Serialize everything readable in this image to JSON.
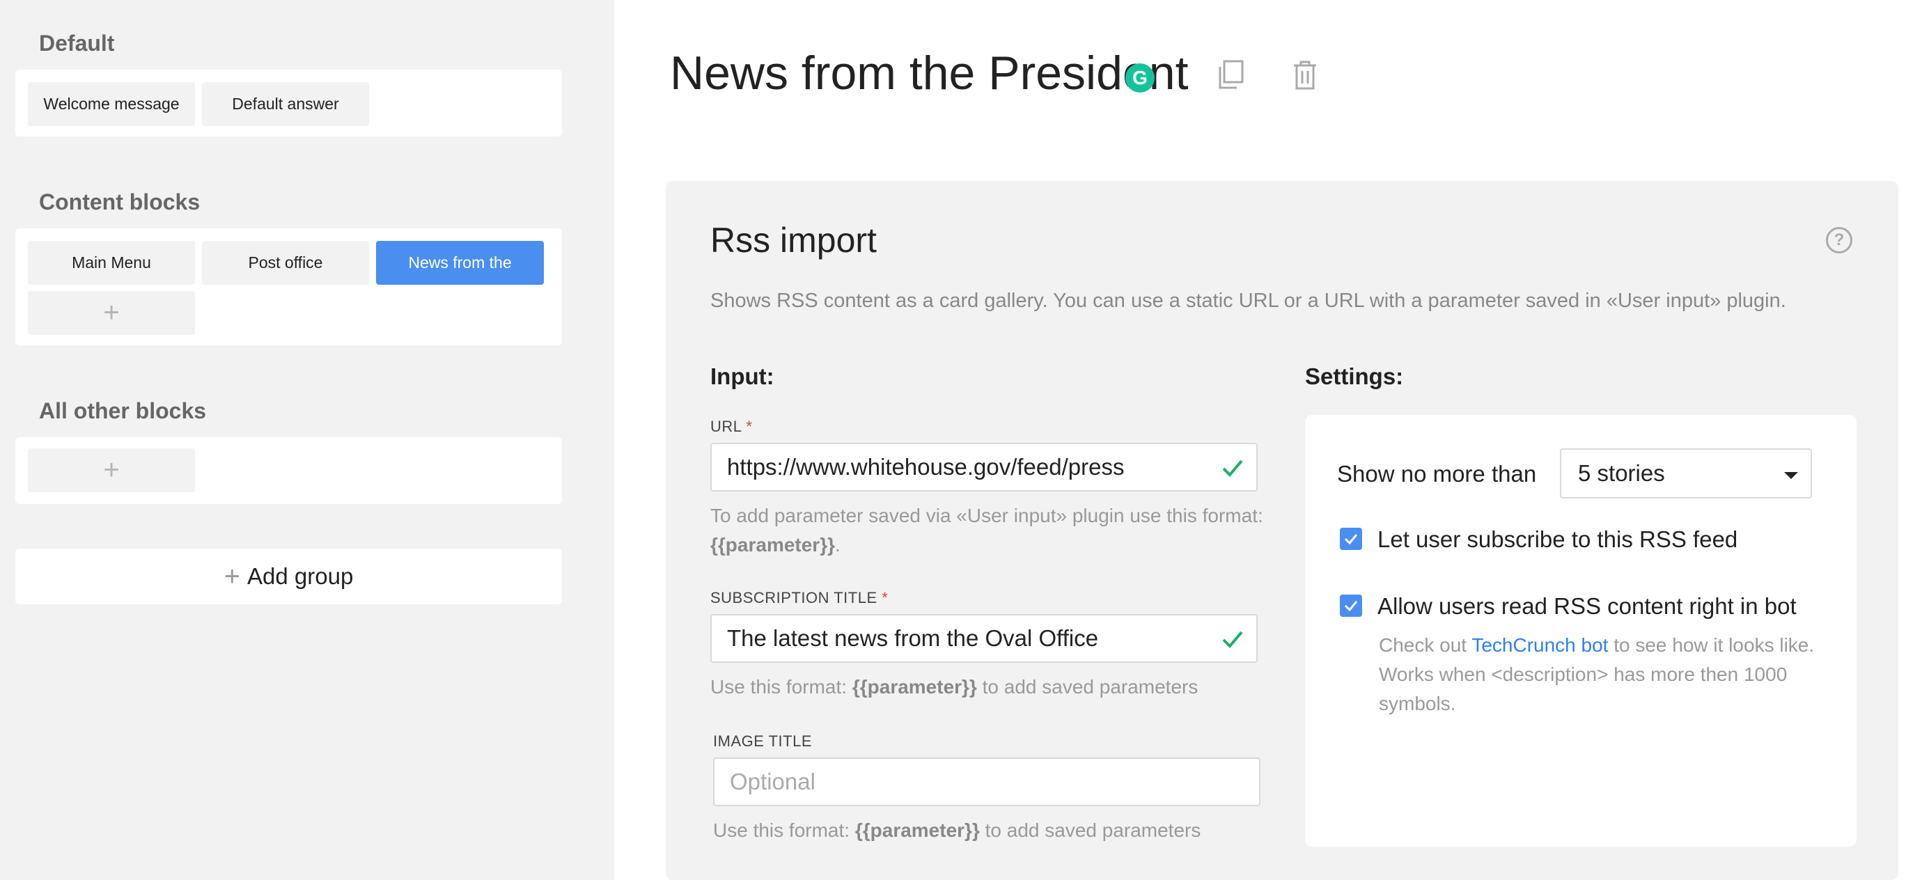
{
  "sidebar": {
    "groups": [
      {
        "title": "Default",
        "blocks": [
          "Welcome message",
          "Default answer"
        ]
      },
      {
        "title": "Content blocks",
        "blocks": [
          "Main Menu",
          "Post office",
          "News from the"
        ]
      },
      {
        "title": "All other blocks",
        "blocks": []
      }
    ],
    "add_symbol": "+",
    "add_group_label": "Add group"
  },
  "header": {
    "title": "News from the President",
    "grammarly_letter": "G"
  },
  "plugin": {
    "title": "Rss import",
    "help_symbol": "?",
    "description": "Shows RSS content as a card gallery. You can use a static URL or a URL with a parameter saved in «User input» plugin.",
    "input_title": "Input:",
    "url_label": "URL",
    "required_mark": "*",
    "url_value": "https://www.whitehouse.gov/feed/press",
    "url_hint_prefix": "To add parameter saved via «User input» plugin use this format: ",
    "parameter_token": "{{parameter}}",
    "url_hint_suffix": ".",
    "subscription_label": "SUBSCRIPTION TITLE",
    "subscription_value": "The latest news from the Oval Office",
    "param_hint_prefix": "Use this format: ",
    "param_hint_suffix": " to add saved parameters",
    "image_title_label": "IMAGE TITLE",
    "image_title_placeholder": "Optional",
    "settings_title": "Settings:",
    "show_no_more_than_label": "Show no more than",
    "stories_value": "5 stories",
    "subscribe_label": "Let user subscribe to this RSS feed",
    "subscribe_checked": true,
    "read_in_bot_label": "Allow users read RSS content right in bot",
    "read_in_bot_checked": true,
    "read_hint_prefix": "Check out ",
    "read_hint_link": "TechCrunch bot",
    "read_hint_suffix": " to see how it looks like. Works when <description> has more then 1000 symbols."
  },
  "colors": {
    "accent": "#4a8ef0",
    "success": "#1fae6b",
    "required": "#e03c3c",
    "link": "#2f80ed"
  },
  "icons": [
    "copy-icon",
    "trash-icon",
    "help-icon",
    "check-icon",
    "chevron-down-icon",
    "plus-icon",
    "grammarly-icon"
  ]
}
